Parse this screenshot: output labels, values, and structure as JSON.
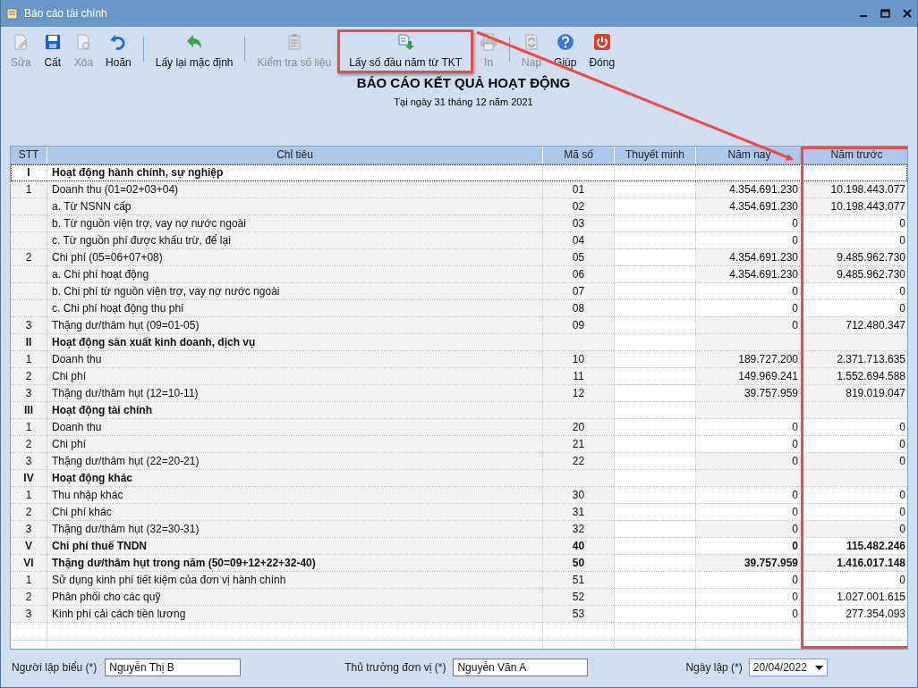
{
  "window": {
    "title": "Báo cáo tài chính"
  },
  "toolbar": [
    {
      "kind": "button",
      "label": "Sửa",
      "disabled": true,
      "highlighted": false
    },
    {
      "kind": "button",
      "label": "Cất",
      "disabled": false,
      "highlighted": false
    },
    {
      "kind": "button",
      "label": "Xóa",
      "disabled": true,
      "highlighted": false
    },
    {
      "kind": "button",
      "label": "Hoãn",
      "disabled": false,
      "highlighted": false
    },
    {
      "kind": "separator"
    },
    {
      "kind": "button",
      "label": "Lấy lại mặc định",
      "disabled": false,
      "highlighted": false
    },
    {
      "kind": "separator"
    },
    {
      "kind": "button",
      "label": "Kiểm tra số liệu",
      "disabled": true,
      "highlighted": false
    },
    {
      "kind": "button",
      "label": "Lấy số đầu năm từ TKT",
      "disabled": false,
      "highlighted": true
    },
    {
      "kind": "button",
      "label": "In",
      "disabled": true,
      "highlighted": false
    },
    {
      "kind": "separator"
    },
    {
      "kind": "button",
      "label": "Nap",
      "disabled": true,
      "highlighted": false
    },
    {
      "kind": "button",
      "label": "Giúp",
      "disabled": false,
      "highlighted": false
    },
    {
      "kind": "button",
      "label": "Đóng",
      "disabled": false,
      "highlighted": false
    }
  ],
  "report": {
    "title": "BÁO CÁO KẾT QUẢ HOẠT ĐỘNG",
    "subtitle": "Tại ngày 31 tháng 12 năm 2021"
  },
  "table": {
    "columns": [
      {
        "label": "STT",
        "highlighted": false
      },
      {
        "label": "Chỉ tiêu",
        "highlighted": false
      },
      {
        "label": "Mã số",
        "highlighted": false
      },
      {
        "label": "Thuyết minh",
        "highlighted": false
      },
      {
        "label": "Năm nay",
        "highlighted": false
      },
      {
        "label": "Năm trước",
        "highlighted": true
      }
    ],
    "rows": [
      {
        "kind": "section",
        "stt": "I",
        "label": "Hoạt động hành chính, sự nghiệp",
        "code": "",
        "current": "",
        "previous": "",
        "selected": true,
        "locked": false
      },
      {
        "kind": "item",
        "stt": "1",
        "label": "Doanh thu (01=02+03+04)",
        "code": "01",
        "current": "4.354.691.230",
        "previous": "10.198.443.077",
        "selected": false,
        "locked": true
      },
      {
        "kind": "item",
        "stt": "",
        "label": "a. Từ NSNN cấp",
        "code": "02",
        "current": "4.354.691.230",
        "previous": "10.198.443.077",
        "selected": false,
        "locked": true
      },
      {
        "kind": "item",
        "stt": "",
        "label": "b. Từ nguồn viện trợ, vay nợ nước ngoài",
        "code": "03",
        "current": "0",
        "previous": "0",
        "selected": false,
        "locked": false
      },
      {
        "kind": "item",
        "stt": "",
        "label": "c. Từ nguồn phí được khấu trừ, để lại",
        "code": "04",
        "current": "0",
        "previous": "0",
        "selected": false,
        "locked": false
      },
      {
        "kind": "item",
        "stt": "2",
        "label": "Chi phí (05=06+07+08)",
        "code": "05",
        "current": "4.354.691.230",
        "previous": "9.485.962.730",
        "selected": false,
        "locked": true
      },
      {
        "kind": "item",
        "stt": "",
        "label": "a. Chi phí hoạt động",
        "code": "06",
        "current": "4.354.691.230",
        "previous": "9.485.962.730",
        "selected": false,
        "locked": true
      },
      {
        "kind": "item",
        "stt": "",
        "label": "b. Chi phí từ nguồn viện trợ, vay nợ nước ngoài",
        "code": "07",
        "current": "0",
        "previous": "0",
        "selected": false,
        "locked": false
      },
      {
        "kind": "item",
        "stt": "",
        "label": "c. Chi phí hoạt động thu phí",
        "code": "08",
        "current": "0",
        "previous": "0",
        "selected": false,
        "locked": false
      },
      {
        "kind": "item",
        "stt": "3",
        "label": "Thặng dư/thâm hụt (09=01-05)",
        "code": "09",
        "current": "0",
        "previous": "712.480.347",
        "selected": false,
        "locked": true
      },
      {
        "kind": "section",
        "stt": "II",
        "label": "Hoạt động sản xuất kinh doanh, dịch vụ",
        "code": "",
        "current": "",
        "previous": "",
        "selected": false,
        "locked": true
      },
      {
        "kind": "item",
        "stt": "1",
        "label": "Doanh thu",
        "code": "10",
        "current": "189.727.200",
        "previous": "2.371.713.635",
        "selected": false,
        "locked": true
      },
      {
        "kind": "item",
        "stt": "2",
        "label": "Chi phí",
        "code": "11",
        "current": "149.969.241",
        "previous": "1.552.694.588",
        "selected": false,
        "locked": true
      },
      {
        "kind": "item",
        "stt": "3",
        "label": "Thặng dư/thâm hụt (12=10-11)",
        "code": "12",
        "current": "39.757.959",
        "previous": "819.019.047",
        "selected": false,
        "locked": true
      },
      {
        "kind": "section",
        "stt": "III",
        "label": "Hoạt động tài chính",
        "code": "",
        "current": "",
        "previous": "",
        "selected": false,
        "locked": true
      },
      {
        "kind": "item",
        "stt": "1",
        "label": "Doanh thu",
        "code": "20",
        "current": "0",
        "previous": "0",
        "selected": false,
        "locked": false
      },
      {
        "kind": "item",
        "stt": "2",
        "label": "Chi phí",
        "code": "21",
        "current": "0",
        "previous": "0",
        "selected": false,
        "locked": false
      },
      {
        "kind": "item",
        "stt": "3",
        "label": "Thặng dư/thâm hụt (22=20-21)",
        "code": "22",
        "current": "0",
        "previous": "0",
        "selected": false,
        "locked": true
      },
      {
        "kind": "section",
        "stt": "IV",
        "label": "Hoạt động khác",
        "code": "",
        "current": "",
        "previous": "",
        "selected": false,
        "locked": true
      },
      {
        "kind": "item",
        "stt": "1",
        "label": "Thu nhập khác",
        "code": "30",
        "current": "0",
        "previous": "0",
        "selected": false,
        "locked": false
      },
      {
        "kind": "item",
        "stt": "2",
        "label": "Chi phí khác",
        "code": "31",
        "current": "0",
        "previous": "0",
        "selected": false,
        "locked": false
      },
      {
        "kind": "item",
        "stt": "3",
        "label": "Thặng dư/thâm hụt (32=30-31)",
        "code": "32",
        "current": "0",
        "previous": "0",
        "selected": false,
        "locked": true
      },
      {
        "kind": "section",
        "stt": "V",
        "label": "Chi phí thuế TNDN",
        "code": "40",
        "current": "0",
        "previous": "115.482.246",
        "selected": false,
        "locked": false
      },
      {
        "kind": "section",
        "stt": "VI",
        "label": "Thặng dư/thâm hụt trong năm (50=09+12+22+32-40)",
        "code": "50",
        "current": "39.757.959",
        "previous": "1.416.017.148",
        "selected": false,
        "locked": true
      },
      {
        "kind": "item",
        "stt": "1",
        "label": "Sử dụng kinh phí tiết kiệm của đơn vị hành chính",
        "code": "51",
        "current": "0",
        "previous": "0",
        "selected": false,
        "locked": false
      },
      {
        "kind": "item",
        "stt": "2",
        "label": "Phân phối cho các quỹ",
        "code": "52",
        "current": "0",
        "previous": "1.027.001.615",
        "selected": false,
        "locked": false
      },
      {
        "kind": "item",
        "stt": "3",
        "label": "Kinh phí cải cách tiền lương",
        "code": "53",
        "current": "0",
        "previous": "277.354.093",
        "selected": false,
        "locked": false
      }
    ]
  },
  "footer": {
    "preparer_label": "Người lập biểu (*)",
    "preparer": "Nguyễn Thị B",
    "head_label": "Thủ trưởng đơn vị (*)",
    "head": "Nguyễn Văn A",
    "date_label": "Ngày lập (*)",
    "date": "20/04/2022"
  }
}
